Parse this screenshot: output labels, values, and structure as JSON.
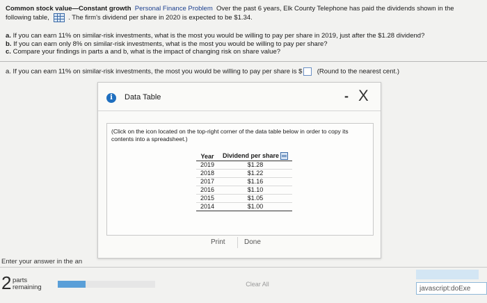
{
  "problem": {
    "title": "Common stock value—Constant growth",
    "tag": "Personal Finance Problem",
    "text1": "Over the past 6 years, Elk County Telephone has paid the dividends shown in the",
    "text2a": "following table,",
    "text2b": ". The firm's dividend per share in 2020 is expected to be $1.34."
  },
  "questions": [
    {
      "label": "a.",
      "text": "If you can earn 11% on similar-risk investments, what is the most you would be willing to pay per share in 2019, just after the $1.28 dividend?"
    },
    {
      "label": "b.",
      "text": "If you can earn only 8% on similar-risk investments, what is the most you would be willing to pay per share?"
    },
    {
      "label": "c.",
      "text": "Compare your findings in parts a and b, what is the impact of changing risk on share value?"
    }
  ],
  "answer": {
    "prefix": "a.  If you can earn 11% on similar-risk investments, the most you would be willing to pay per share is $",
    "value": "",
    "note": "(Round to the nearest cent.)"
  },
  "modal": {
    "title": "Data Table",
    "minimize": "-",
    "close": "X",
    "instructions": "(Click on the icon located on the top-right corner of the data table below in order to copy its contents into a spreadsheet.)",
    "table": {
      "headers": [
        "Year",
        "Dividend per share"
      ],
      "rows": [
        [
          "2019",
          "$1.28"
        ],
        [
          "2018",
          "$1.22"
        ],
        [
          "2017",
          "$1.16"
        ],
        [
          "2016",
          "$1.10"
        ],
        [
          "2015",
          "$1.05"
        ],
        [
          "2014",
          "$1.00"
        ]
      ]
    },
    "print_label": "Print",
    "done_label": "Done"
  },
  "footer": {
    "enter_answer": "Enter your answer in the an",
    "parts_count": "2",
    "parts_label_1": "parts",
    "parts_label_2": "remaining",
    "clear_all": "Clear All",
    "status": "javascript:doExe"
  },
  "colors": {
    "accent": "#1f6fbf",
    "progress": "#5a9fd8"
  }
}
